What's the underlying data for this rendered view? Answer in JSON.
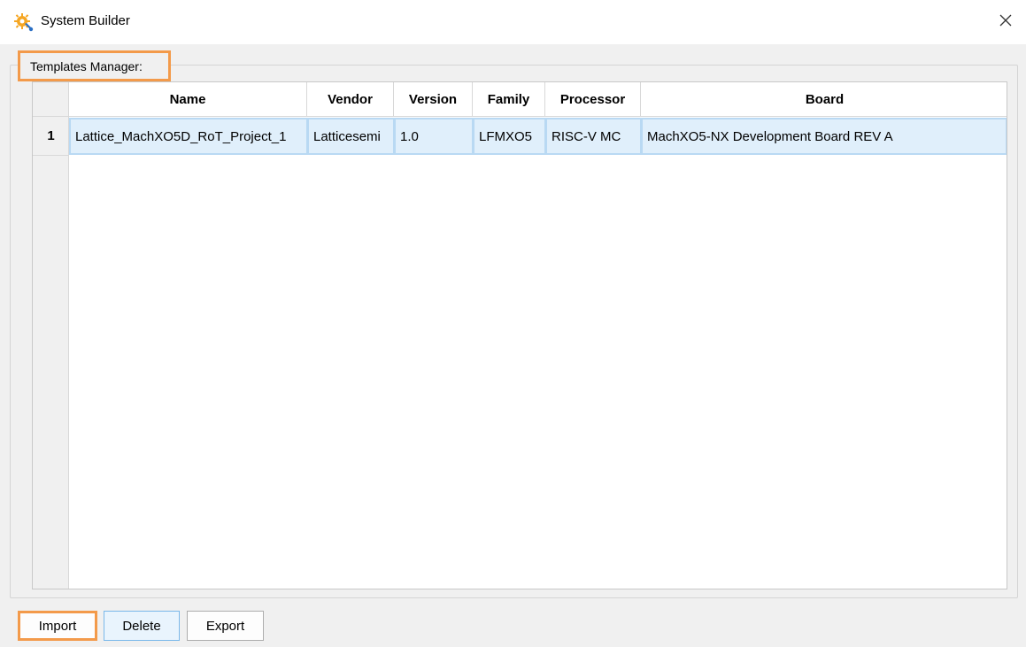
{
  "window": {
    "title": "System Builder",
    "app_icon": "system-builder-gear-icon",
    "close_icon": "close-icon"
  },
  "group": {
    "title": "Templates Manager:"
  },
  "table": {
    "columns": [
      "Name",
      "Vendor",
      "Version",
      "Family",
      "Processor",
      "Board"
    ],
    "rows": [
      {
        "number": "1",
        "cells": [
          "Lattice_MachXO5D_RoT_Project_1",
          "Latticesemi",
          "1.0",
          "LFMXO5",
          "RISC-V MC",
          "MachXO5-NX Development Board REV A"
        ]
      }
    ]
  },
  "buttons": {
    "import": "Import",
    "delete": "Delete",
    "export": "Export"
  },
  "colors": {
    "highlight": "#f39a4a",
    "row_selected_bg": "#e0effb",
    "row_selected_border": "#b9d9f3"
  }
}
